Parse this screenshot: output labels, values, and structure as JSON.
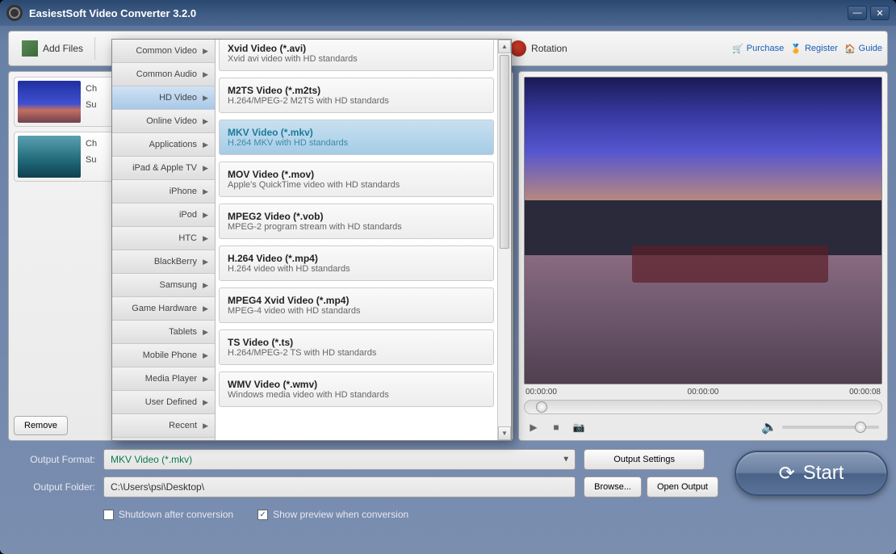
{
  "window": {
    "title": "EasiestSoft Video Converter 3.2.0"
  },
  "toolbar": {
    "add_files": "Add Files",
    "rotation": "Rotation",
    "purchase": "Purchase",
    "register": "Register",
    "guide": "Guide"
  },
  "file_list": {
    "items": [
      {
        "line1": "Ch",
        "line2": "Su",
        "thumb_class": "thumb-art1"
      },
      {
        "line1": "Ch",
        "line2": "Su",
        "thumb_class": "thumb-art2"
      }
    ],
    "remove": "Remove"
  },
  "preview": {
    "t0": "00:00:00",
    "t1": "00:00:00",
    "t2": "00:00:08"
  },
  "dropdown": {
    "categories": [
      {
        "label": "Common Video",
        "sel": false
      },
      {
        "label": "Common Audio",
        "sel": false
      },
      {
        "label": "HD Video",
        "sel": true
      },
      {
        "label": "Online Video",
        "sel": false
      },
      {
        "label": "Applications",
        "sel": false
      },
      {
        "label": "iPad & Apple TV",
        "sel": false
      },
      {
        "label": "iPhone",
        "sel": false
      },
      {
        "label": "iPod",
        "sel": false
      },
      {
        "label": "HTC",
        "sel": false
      },
      {
        "label": "BlackBerry",
        "sel": false
      },
      {
        "label": "Samsung",
        "sel": false
      },
      {
        "label": "Game Hardware",
        "sel": false
      },
      {
        "label": "Tablets",
        "sel": false
      },
      {
        "label": "Mobile Phone",
        "sel": false
      },
      {
        "label": "Media Player",
        "sel": false
      },
      {
        "label": "User Defined",
        "sel": false
      },
      {
        "label": "Recent",
        "sel": false
      }
    ],
    "formats": [
      {
        "title": "Xvid Video (*.avi)",
        "desc": "Xvid avi video with HD standards",
        "sel": false,
        "first": true
      },
      {
        "title": "M2TS Video (*.m2ts)",
        "desc": "H.264/MPEG-2 M2TS with HD standards",
        "sel": false
      },
      {
        "title": "MKV Video (*.mkv)",
        "desc": "H.264 MKV with HD standards",
        "sel": true
      },
      {
        "title": "MOV Video (*.mov)",
        "desc": "Apple's QuickTime video with HD standards",
        "sel": false
      },
      {
        "title": "MPEG2 Video (*.vob)",
        "desc": "MPEG-2 program stream with HD standards",
        "sel": false
      },
      {
        "title": "H.264 Video (*.mp4)",
        "desc": "H.264 video with HD standards",
        "sel": false
      },
      {
        "title": "MPEG4 Xvid Video (*.mp4)",
        "desc": "MPEG-4 video with HD standards",
        "sel": false
      },
      {
        "title": "TS Video (*.ts)",
        "desc": "H.264/MPEG-2 TS with HD standards",
        "sel": false
      },
      {
        "title": "WMV Video (*.wmv)",
        "desc": "Windows media video with HD standards",
        "sel": false
      }
    ]
  },
  "output": {
    "format_label": "Output Format:",
    "format_value": "MKV Video (*.mkv)",
    "folder_label": "Output Folder:",
    "folder_value": "C:\\Users\\psi\\Desktop\\",
    "settings": "Output Settings",
    "browse": "Browse...",
    "open": "Open Output"
  },
  "start": {
    "label": "Start"
  },
  "checks": {
    "shutdown": "Shutdown after conversion",
    "preview": "Show preview when conversion",
    "shutdown_checked": false,
    "preview_checked": true
  }
}
